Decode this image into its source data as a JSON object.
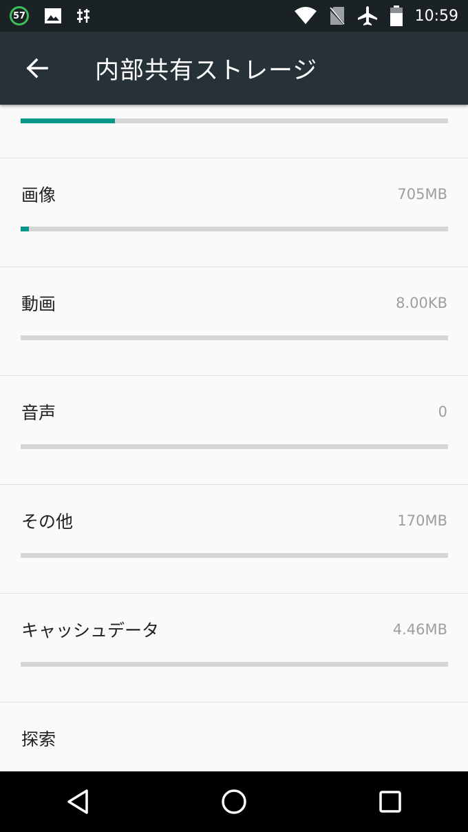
{
  "status_bar": {
    "battery_percent_badge": "57",
    "time": "10:59",
    "icons": [
      "battery-circle-icon",
      "image-icon",
      "equalizer-icon",
      "wifi-icon",
      "no-sim-icon",
      "airplane-icon",
      "battery-icon"
    ]
  },
  "app_bar": {
    "title": "内部共有ストレージ",
    "back_icon": "arrow-left-icon"
  },
  "total_usage": {
    "fraction": 0.22
  },
  "categories": [
    {
      "label": "画像",
      "value": "705MB",
      "fraction": 0.02
    },
    {
      "label": "動画",
      "value": "8.00KB",
      "fraction": 0
    },
    {
      "label": "音声",
      "value": "0",
      "fraction": 0
    },
    {
      "label": "その他",
      "value": "170MB",
      "fraction": 0
    },
    {
      "label": "キャッシュデータ",
      "value": "4.46MB",
      "fraction": 0
    }
  ],
  "explore": {
    "label": "探索"
  },
  "nav_bar": {
    "icons": [
      "back-triangle-icon",
      "home-circle-icon",
      "recents-square-icon"
    ]
  },
  "colors": {
    "accent": "#009688",
    "app_bar": "#263238",
    "status_bar": "#1b2226",
    "track": "#d6d6d6"
  }
}
